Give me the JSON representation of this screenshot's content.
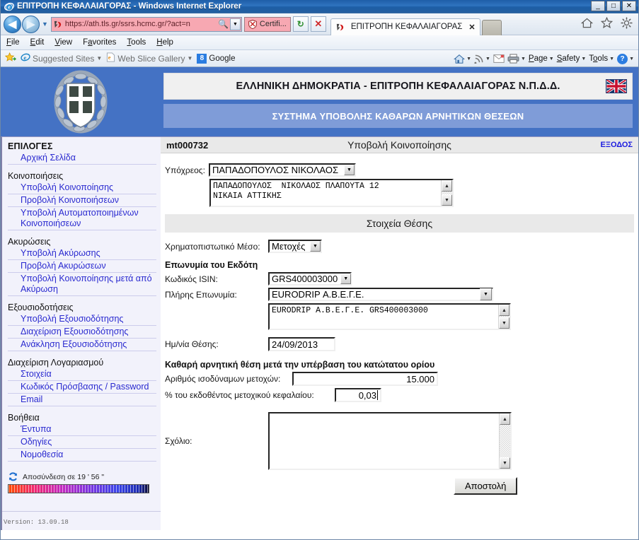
{
  "window": {
    "title": "ΕΠΙΤΡΟΠΗ ΚΕΦΑΛΑΙΑΓΟΡΑΣ - Windows Internet Explorer",
    "minimize": "_",
    "maximize": "□",
    "close": "✕"
  },
  "browser": {
    "back": "◀",
    "forward": "▶",
    "url": "https://ath.tls.gr/ssrs.hcmc.gr/?act=n",
    "url_host_bold": "tls.gr",
    "certificate_label": "Certifi...",
    "refresh": "↻",
    "stop": "✕",
    "tab_title": "ΕΠΙΤΡΟΠΗ ΚΕΦΑΛΑΙΑΓΟΡΑΣ",
    "tab_close": "✕",
    "right_icons": [
      "home-icon",
      "favorites-star-icon",
      "settings-gear-icon"
    ]
  },
  "menubar": [
    {
      "label": "File",
      "accel": "F"
    },
    {
      "label": "Edit",
      "accel": "E"
    },
    {
      "label": "View",
      "accel": "V"
    },
    {
      "label": "Favorites",
      "accel": "a"
    },
    {
      "label": "Tools",
      "accel": "T"
    },
    {
      "label": "Help",
      "accel": "H"
    }
  ],
  "favoritesbar": {
    "suggested_sites": "Suggested Sites",
    "web_slice_gallery": "Web Slice Gallery",
    "google": "Google",
    "commands": [
      {
        "label": "Page"
      },
      {
        "label": "Safety"
      },
      {
        "label": "Tools"
      }
    ]
  },
  "header": {
    "title_line1": "ΕΛΛΗΝΙΚΗ ΔΗΜΟΚΡΑΤΙΑ - ΕΠΙΤΡΟΠΗ ΚΕΦΑΛΑΙΑΓΟΡΑΣ Ν.Π.Δ.Δ.",
    "title_line2": "ΣΥΣΤΗΜΑ ΥΠΟΒΟΛΗΣ ΚΑΘΑΡΩΝ ΑΡΝΗΤΙΚΩΝ ΘΕΣΕΩΝ",
    "flag": "uk-flag-icon",
    "emblem": "greek-coat-of-arms"
  },
  "sidebar": {
    "heading": "ΕΠΙΛΟΓΕΣ",
    "home_link": "Αρχική Σελίδα",
    "groups": [
      {
        "title": "Κοινοποιήσεις",
        "items": [
          "Υποβολή Κοινοποίησης",
          "Προβολή Κοινοποιήσεων",
          "Υποβολή Αυτοματοποιημένων Κοινοποιήσεων"
        ]
      },
      {
        "title": "Ακυρώσεις",
        "items": [
          "Υποβολή Ακύρωσης",
          "Προβολή Ακυρώσεων",
          "Υποβολή Κοινοποίησης μετά από Ακύρωση"
        ]
      },
      {
        "title": "Εξουσιοδοτήσεις",
        "items": [
          "Υποβολή Εξουσιοδότησης",
          "Διαχείριση Εξουσιοδότησης",
          "Ανάκληση Εξουσιοδότησης"
        ]
      },
      {
        "title": "Διαχείριση Λογαριασμού",
        "items": [
          "Στοιχεία",
          "Κωδικός Πρόσβασης / Password",
          "Email"
        ]
      },
      {
        "title": "Βοήθεια",
        "items": [
          "Έντυπα",
          "Οδηγίες",
          "Νομοθεσία"
        ]
      }
    ],
    "logout_text": "Αποσύνδεση σε 19 ' 56 \"",
    "version": "Version: 13.09.18"
  },
  "pagehead": {
    "code": "mt000732",
    "title": "Υποβολή Κοινοποίησης",
    "exit": "ΕΞΟΔΟΣ"
  },
  "form": {
    "obligor_label": "Υπόχρεος:",
    "obligor_value": "ΠΑΠΑΔΟΠΟΥΛΟΣ ΝΙΚΟΛΑΟΣ",
    "obligor_details": "ΠΑΠΑΔΟΠΟΥΛΟΣ  ΝΙΚΟΛΑΟΣ ΠΛΑΠΟΥΤΑ 12\nΝΙΚΑΙΑ ΑΤΤΙΚΗΣ",
    "section_title": "Στοιχεία Θέσης",
    "instrument_label": "Χρηματοπιστωτικό Μέσο:",
    "instrument_value": "Μετοχές",
    "issuer_heading": "Επωνυμία του Εκδότη",
    "isin_label": "Κωδικός ISIN:",
    "isin_value": "GRS400003000",
    "fullname_label": "Πλήρης Επωνυμία:",
    "fullname_value": "EURODRIP Α.Β.Ε.Γ.Ε.",
    "issuer_details": "EURODRIP Α.Β.Ε.Γ.Ε. GRS400003000",
    "date_label": "Ημ/νία Θέσης:",
    "date_value": "24/09/2013",
    "net_short_heading": "Καθαρή αρνητική θέση μετά την υπέρβαση του κατώτατου ορίου",
    "shares_label": "Αριθμός ισοδύναμων μετοχών:",
    "shares_value": "15.000",
    "percent_label": "% του εκδοθέντος μετοχικού κεφαλαίου:",
    "percent_value": "0,03",
    "comment_label": "Σχόλιο:",
    "comment_value": "",
    "submit_label": "Αποστολή"
  }
}
